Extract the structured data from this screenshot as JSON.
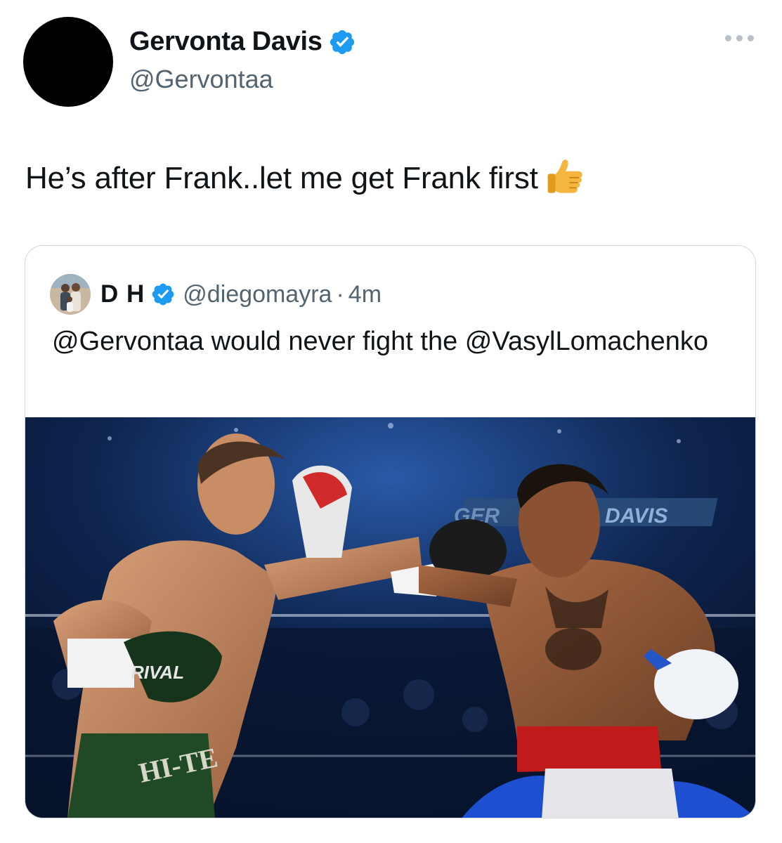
{
  "author": {
    "display_name": "Gervonta Davis",
    "handle": "@Gervontaa",
    "verified": true
  },
  "tweet": {
    "text": "He’s after Frank..let me get Frank first",
    "emoji": "thumbs-up"
  },
  "quoted_tweet": {
    "display_name": "D H",
    "handle": "@diegomayra",
    "separator": "·",
    "time": "4m",
    "text": "@Gervontaa would never fight the @VasylLomachenko",
    "media": {
      "alt": "Boxing match photo of two fighters exchanging punches",
      "glove_brand": "RIVAL",
      "trunks_text": "HI-TE",
      "banner_left": "GER",
      "banner_right": "DAVIS"
    }
  },
  "colors": {
    "verified_blue": "#1d9bf0",
    "secondary_text": "#536471",
    "border": "#cfd9de"
  }
}
